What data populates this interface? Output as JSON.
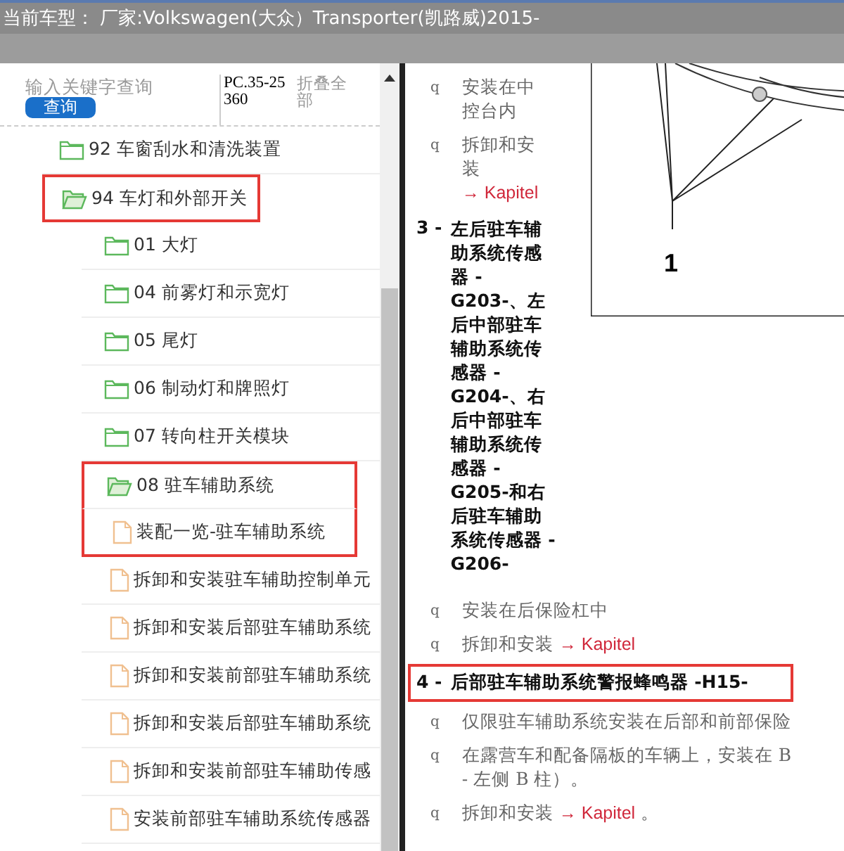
{
  "title": "当前车型： 厂家:Volkswagen(大众）Transporter(凯路威)2015-",
  "search": {
    "placeholder": "输入关键字查询",
    "button": "查询",
    "code": "PC.35-25360",
    "collapse_all": "折叠全部"
  },
  "tree": [
    {
      "kind": "folder",
      "label": "92 车窗刮水和清洗装置",
      "expanded": false,
      "highlighted": false
    },
    {
      "kind": "folder",
      "label": "94 车灯和外部开关",
      "expanded": true,
      "highlighted": true,
      "children": [
        {
          "kind": "folder",
          "label": "01 大灯",
          "expanded": false,
          "highlighted": false
        },
        {
          "kind": "folder",
          "label": "04 前雾灯和示宽灯",
          "expanded": false,
          "highlighted": false
        },
        {
          "kind": "folder",
          "label": "05 尾灯",
          "expanded": false,
          "highlighted": false
        },
        {
          "kind": "folder",
          "label": "06 制动灯和牌照灯",
          "expanded": false,
          "highlighted": false
        },
        {
          "kind": "folder",
          "label": "07 转向柱开关模块",
          "expanded": false,
          "highlighted": false
        },
        {
          "kind": "folder",
          "label": "08 驻车辅助系统",
          "expanded": true,
          "highlighted": true,
          "children": [
            {
              "kind": "document",
              "label": "装配一览-驻车辅助系统",
              "highlighted": true
            },
            {
              "kind": "document",
              "label": "拆卸和安装驻车辅助控制单元",
              "highlighted": false
            },
            {
              "kind": "document",
              "label": "拆卸和安装后部驻车辅助系统",
              "highlighted": false
            },
            {
              "kind": "document",
              "label": "拆卸和安装前部驻车辅助系统",
              "highlighted": false
            },
            {
              "kind": "document",
              "label": "拆卸和安装后部驻车辅助系统",
              "highlighted": false
            },
            {
              "kind": "document",
              "label": "拆卸和安装前部驻车辅助传感",
              "highlighted": false
            },
            {
              "kind": "document",
              "label": "安装前部驻车辅助系统传感器",
              "highlighted": false
            }
          ]
        }
      ]
    }
  ],
  "document": {
    "figure_label": "1",
    "side_blocks": [
      {
        "kind": "bullet",
        "marker": "q",
        "text": "安装在中控台内"
      },
      {
        "kind": "bullet",
        "marker": "q",
        "text": "拆卸和安装",
        "link": "→ Kapitel"
      },
      {
        "kind": "heading",
        "number": "3 -",
        "text": "左后驻车辅助系统传感器 -G203-、左后中部驻车辅助系统传感器 -G204-、右后中部驻车辅助系统传感器 -G205-和右后驻车辅助系统传感器 -G206-",
        "highlighted": false
      }
    ],
    "blocks": [
      {
        "kind": "bullet",
        "marker": "q",
        "text": "安装在后保险杠中"
      },
      {
        "kind": "bullet",
        "marker": "q",
        "text": "拆卸和安装",
        "link": "→ Kapitel"
      },
      {
        "kind": "heading",
        "number": "4 -",
        "text": "后部驻车辅助系统警报蜂鸣器 -H15-",
        "highlighted": true
      },
      {
        "kind": "bullet",
        "marker": "q",
        "text": "仅限驻车辅助系统安装在后部和前部保险"
      },
      {
        "kind": "bullet",
        "marker": "q",
        "text": "在露营车和配备隔板的车辆上，安装在 B",
        "continuation": "- 左侧 B 柱）。"
      },
      {
        "kind": "bullet",
        "marker": "q",
        "text": "拆卸和安装",
        "link": "→ Kapitel",
        "trail": "。"
      }
    ]
  }
}
